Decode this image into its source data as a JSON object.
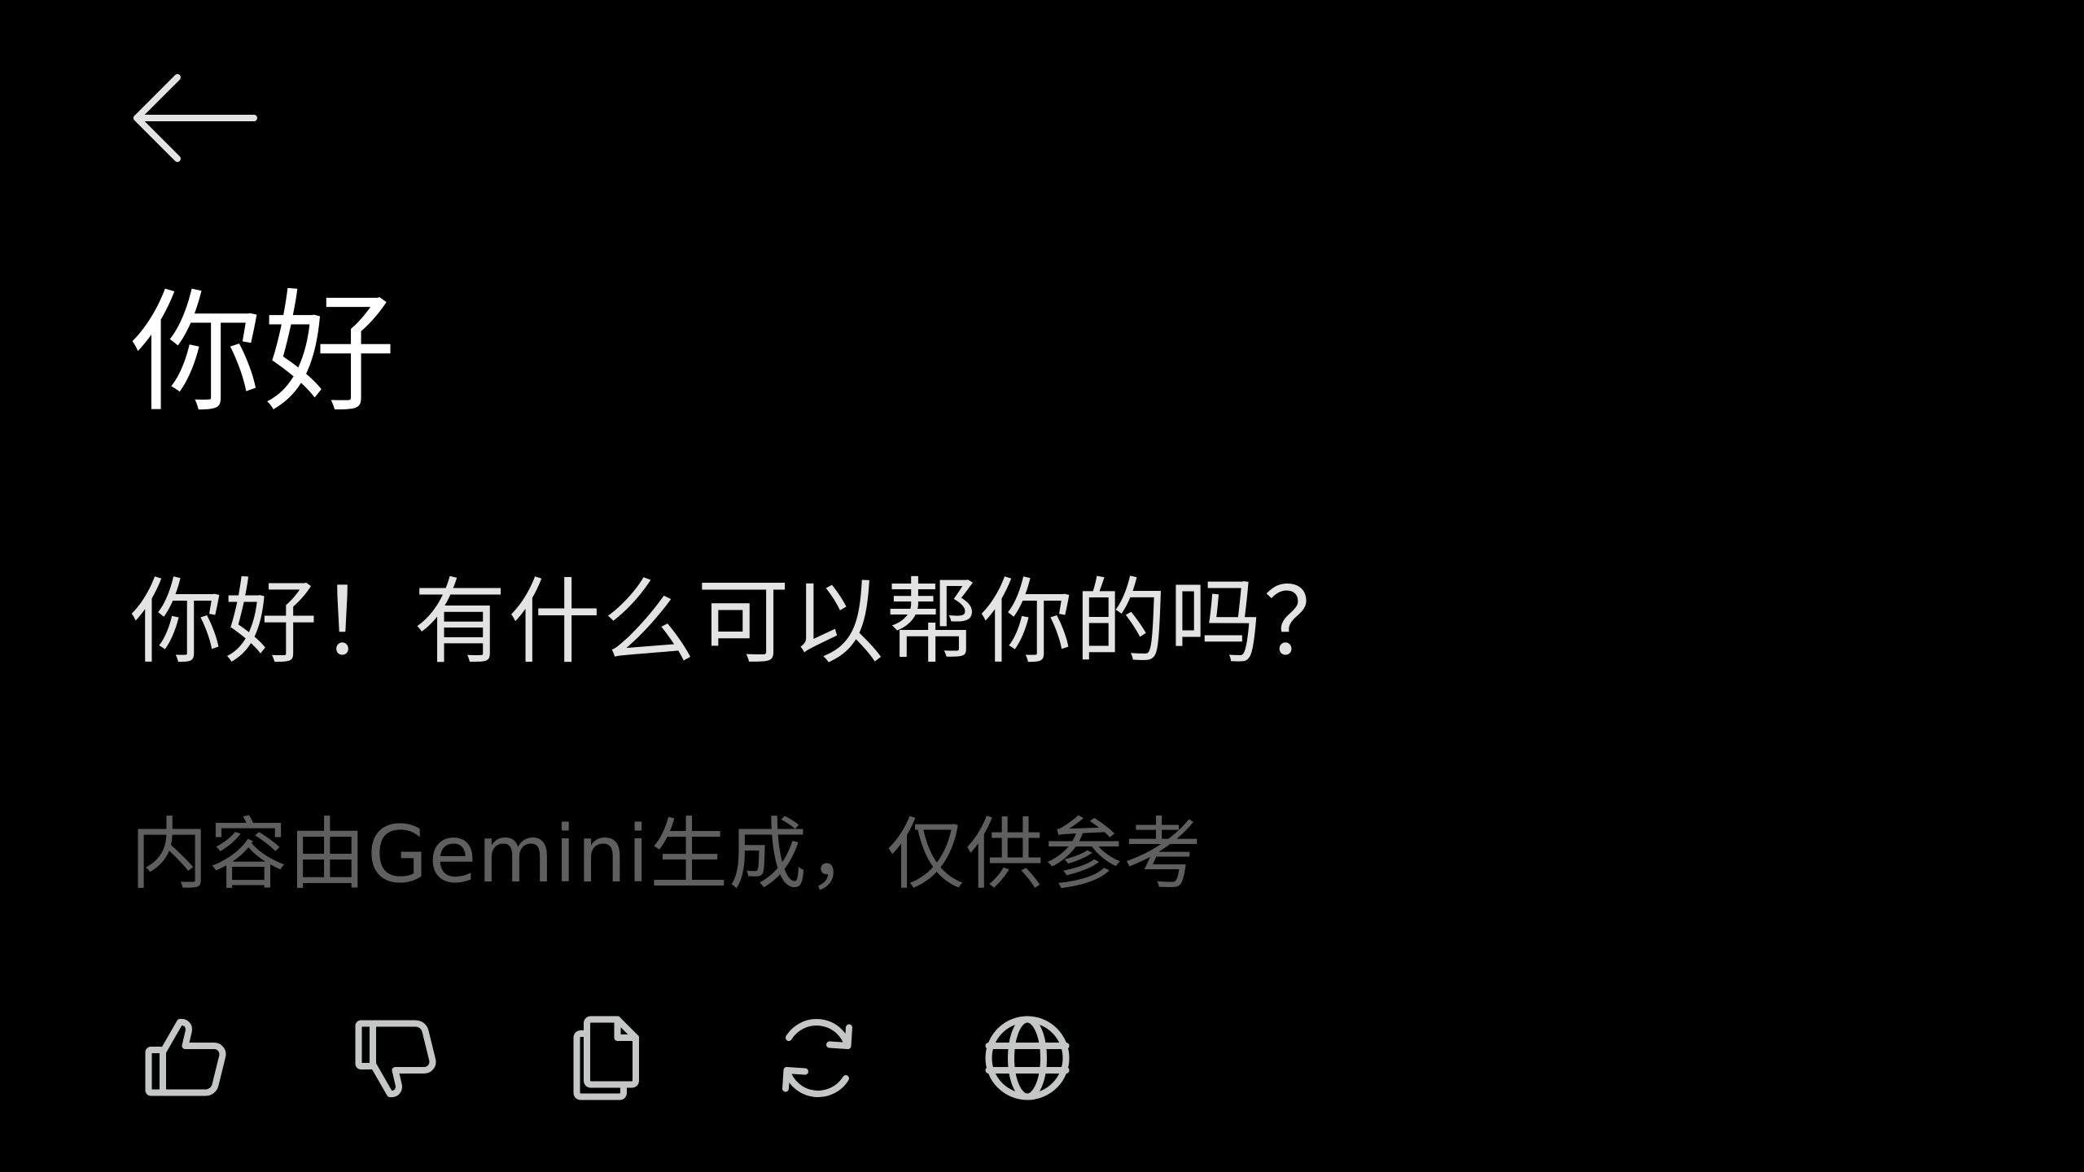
{
  "header": {
    "back_icon": "arrow-left-icon"
  },
  "conversation": {
    "title": "你好",
    "response": "你好！有什么可以帮你的吗？",
    "disclaimer": "内容由Gemini生成，仅供参考"
  },
  "actions": [
    {
      "name": "thumbs-up",
      "icon": "thumbs-up-icon"
    },
    {
      "name": "thumbs-down",
      "icon": "thumbs-down-icon"
    },
    {
      "name": "copy",
      "icon": "copy-icon"
    },
    {
      "name": "regenerate",
      "icon": "refresh-icon"
    },
    {
      "name": "search-web",
      "icon": "globe-icon"
    }
  ],
  "colors": {
    "background": "#000000",
    "title": "#ffffff",
    "response": "#e3e3e3",
    "disclaimer": "#5f5f5f",
    "icon": "#c4c7c5"
  }
}
